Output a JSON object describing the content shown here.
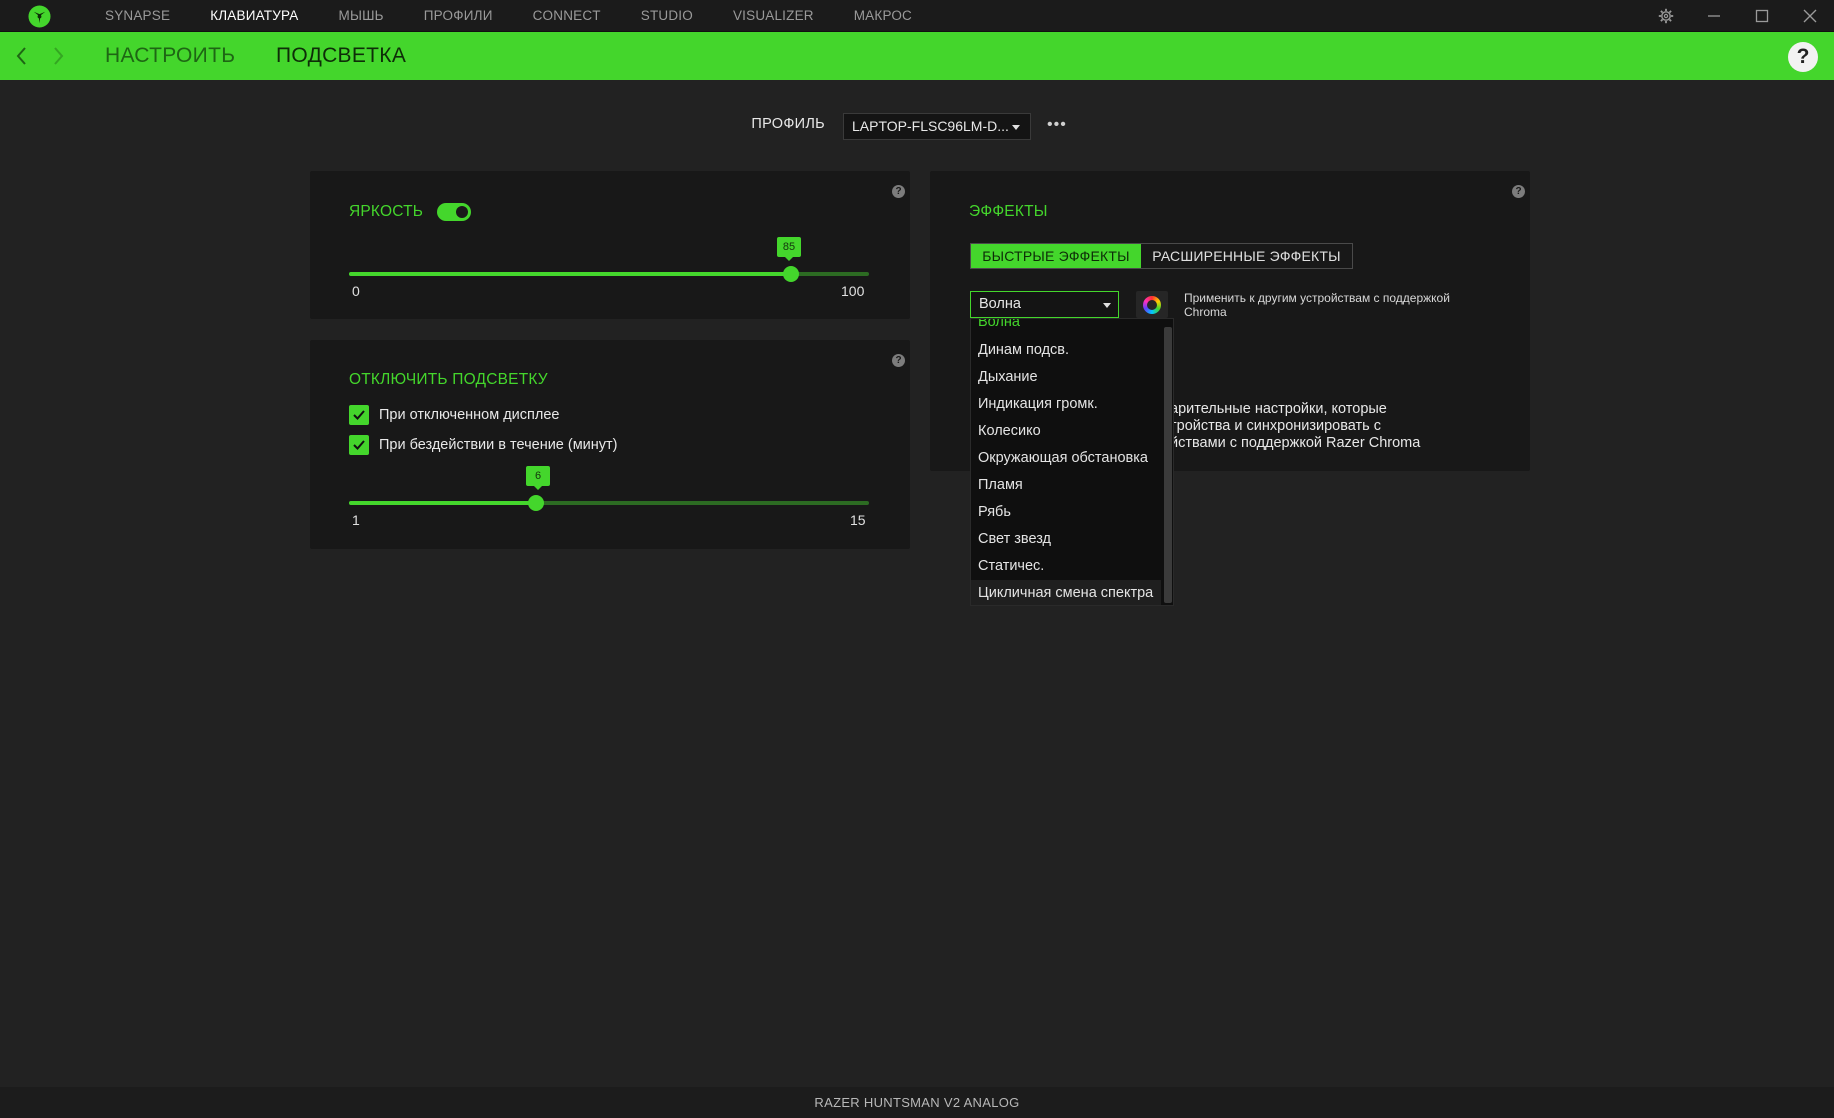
{
  "topnav": {
    "items": [
      "SYNAPSE",
      "КЛАВИАТУРА",
      "МЫШЬ",
      "ПРОФИЛИ",
      "CONNECT",
      "STUDIO",
      "VISUALIZER",
      "МАКРОС"
    ],
    "active_index": 1
  },
  "subnav": {
    "tabs": [
      "НАСТРОИТЬ",
      "ПОДСВЕТКА"
    ],
    "active_index": 1
  },
  "profile": {
    "label": "ПРОФИЛЬ",
    "value": "LAPTOP-FLSC96LM-D..."
  },
  "brightness": {
    "title": "ЯРКОСТЬ",
    "enabled": true,
    "value": 85,
    "min": 0,
    "max": 100,
    "value_label": "85",
    "min_label": "0",
    "max_label": "100"
  },
  "lighting_off": {
    "title": "ОТКЛЮЧИТЬ ПОДСВЕТКУ",
    "checkbox_display_off": {
      "label": "При отключенном дисплее",
      "checked": true
    },
    "checkbox_idle": {
      "label": "При бездействии в течение (минут)",
      "checked": true
    },
    "idle_value": 6,
    "idle_min": 1,
    "idle_max": 15,
    "value_label": "6",
    "min_label": "1",
    "max_label": "15"
  },
  "effects": {
    "title": "ЭФФЕКТЫ",
    "tab_quick": "БЫСТРЫЕ ЭФФЕКТЫ",
    "tab_advanced": "РАСШИРЕННЫЕ ЭФФЕКТЫ",
    "selected_effect": "Волна",
    "apply_text": "Применить к другим устройствам с поддержкой Chroma",
    "partial_line1": "арительные настройки, которые",
    "partial_line2": "тройства и синхронизировать с",
    "partial_line3": "йствами с поддержкой Razer Chroma",
    "options": [
      "Волна",
      "Динам подсв.",
      "Дыхание",
      "Индикация громк.",
      "Колесико",
      "Окружающая обстановка",
      "Пламя",
      "Рябь",
      "Свет звезд",
      "Статичес.",
      "Цикличная смена спектра"
    ]
  },
  "colors": {
    "accent": "#44d62c",
    "panel": "#181818",
    "background": "#222222"
  },
  "footer": {
    "device_name": "RAZER HUNTSMAN V2 ANALOG"
  }
}
